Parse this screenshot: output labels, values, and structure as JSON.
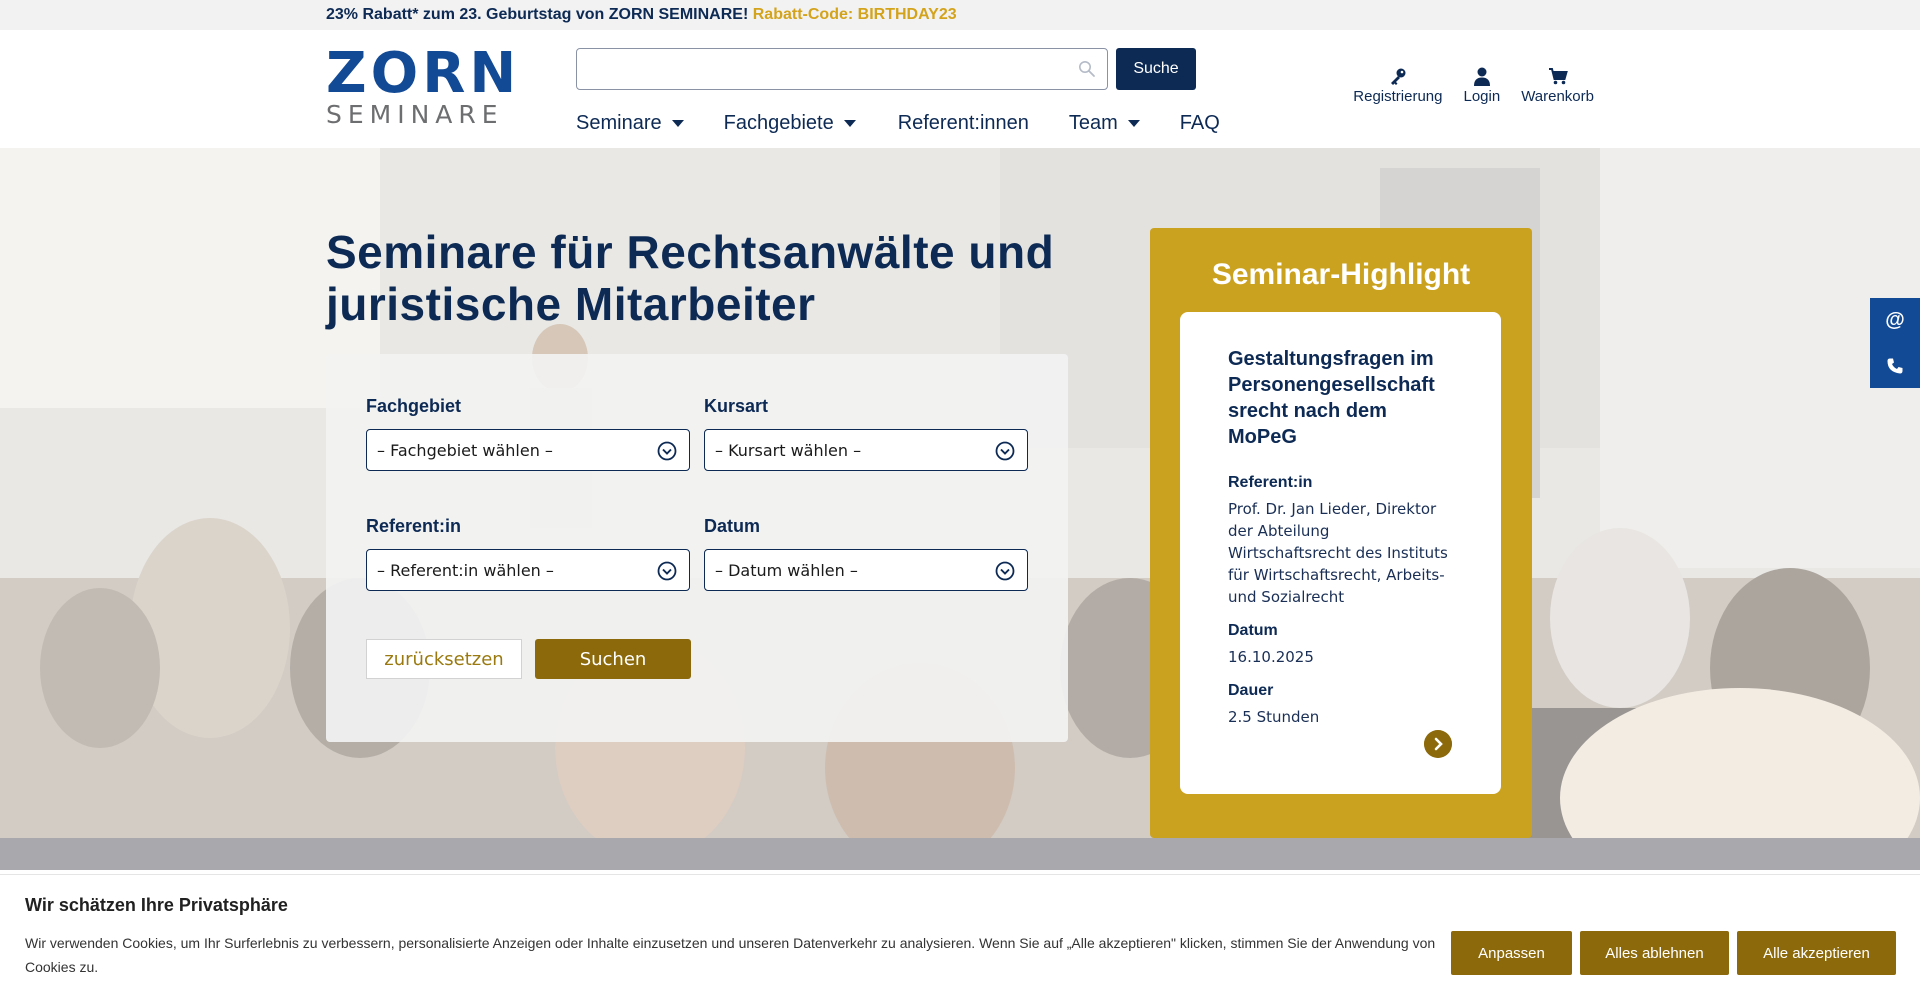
{
  "colors": {
    "navy": "#0d2a54",
    "logo_blue": "#124a95",
    "gold": "#cba21f",
    "dark_gold": "#8c6a0c",
    "promo_code": "#d4a31c"
  },
  "promo": {
    "text": "23% Rabatt* zum 23. Geburtstag von ZORN SEMINARE!",
    "code": "Rabatt-Code: BIRTHDAY23"
  },
  "logo": {
    "line1": "ZORN",
    "line2": "SEMINARE"
  },
  "search": {
    "value": "",
    "placeholder": "",
    "button": "Suche",
    "icon": "search-icon"
  },
  "nav": [
    {
      "label": "Seminare",
      "has_dropdown": true
    },
    {
      "label": "Fachgebiete",
      "has_dropdown": true
    },
    {
      "label": "Referent:innen",
      "has_dropdown": false
    },
    {
      "label": "Team",
      "has_dropdown": true
    },
    {
      "label": "FAQ",
      "has_dropdown": false
    }
  ],
  "header_actions": [
    {
      "label": "Registrierung",
      "icon": "key-icon"
    },
    {
      "label": "Login",
      "icon": "user-icon"
    },
    {
      "label": "Warenkorb",
      "icon": "cart-icon"
    }
  ],
  "hero": {
    "title": "Seminare für Rechtsanwälte und juristische Mitarbeiter"
  },
  "filters": {
    "fachgebiet": {
      "label": "Fachgebiet",
      "value": "– Fachgebiet wählen –"
    },
    "kursart": {
      "label": "Kursart",
      "value": "– Kursart wählen –"
    },
    "referent": {
      "label": "Referent:in",
      "value": "– Referent:in wählen –"
    },
    "datum": {
      "label": "Datum",
      "value": "– Datum wählen –"
    },
    "reset_label": "zurücksetzen",
    "submit_label": "Suchen"
  },
  "highlight": {
    "heading": "Seminar-Highlight",
    "title": "Gestaltungsfragen im Personengesellschaft srecht nach dem MoPeG",
    "referent_label": "Referent:in",
    "referent": "Prof. Dr. Jan Lieder, Direktor der Abteilung Wirtschaftsrecht des Instituts für Wirtschaftsrecht, Arbeits- und Sozialrecht",
    "datum_label": "Datum",
    "datum": "16.10.2025",
    "dauer_label": "Dauer",
    "dauer": "2.5 Stunden"
  },
  "side_contact": [
    {
      "glyph": "@",
      "icon": "email-icon"
    },
    {
      "glyph": "",
      "icon": "phone-icon"
    }
  ],
  "cookie": {
    "title": "Wir schätzen Ihre Privatsphäre",
    "text": "Wir verwenden Cookies, um Ihr Surferlebnis zu verbessern, personalisierte Anzeigen oder Inhalte einzusetzen und unseren Datenverkehr zu analysieren. Wenn Sie auf „Alle akzeptieren\" klicken, stimmen Sie der Anwendung von Cookies zu.",
    "buttons": [
      "Anpassen",
      "Alles ablehnen",
      "Alle akzeptieren"
    ]
  }
}
